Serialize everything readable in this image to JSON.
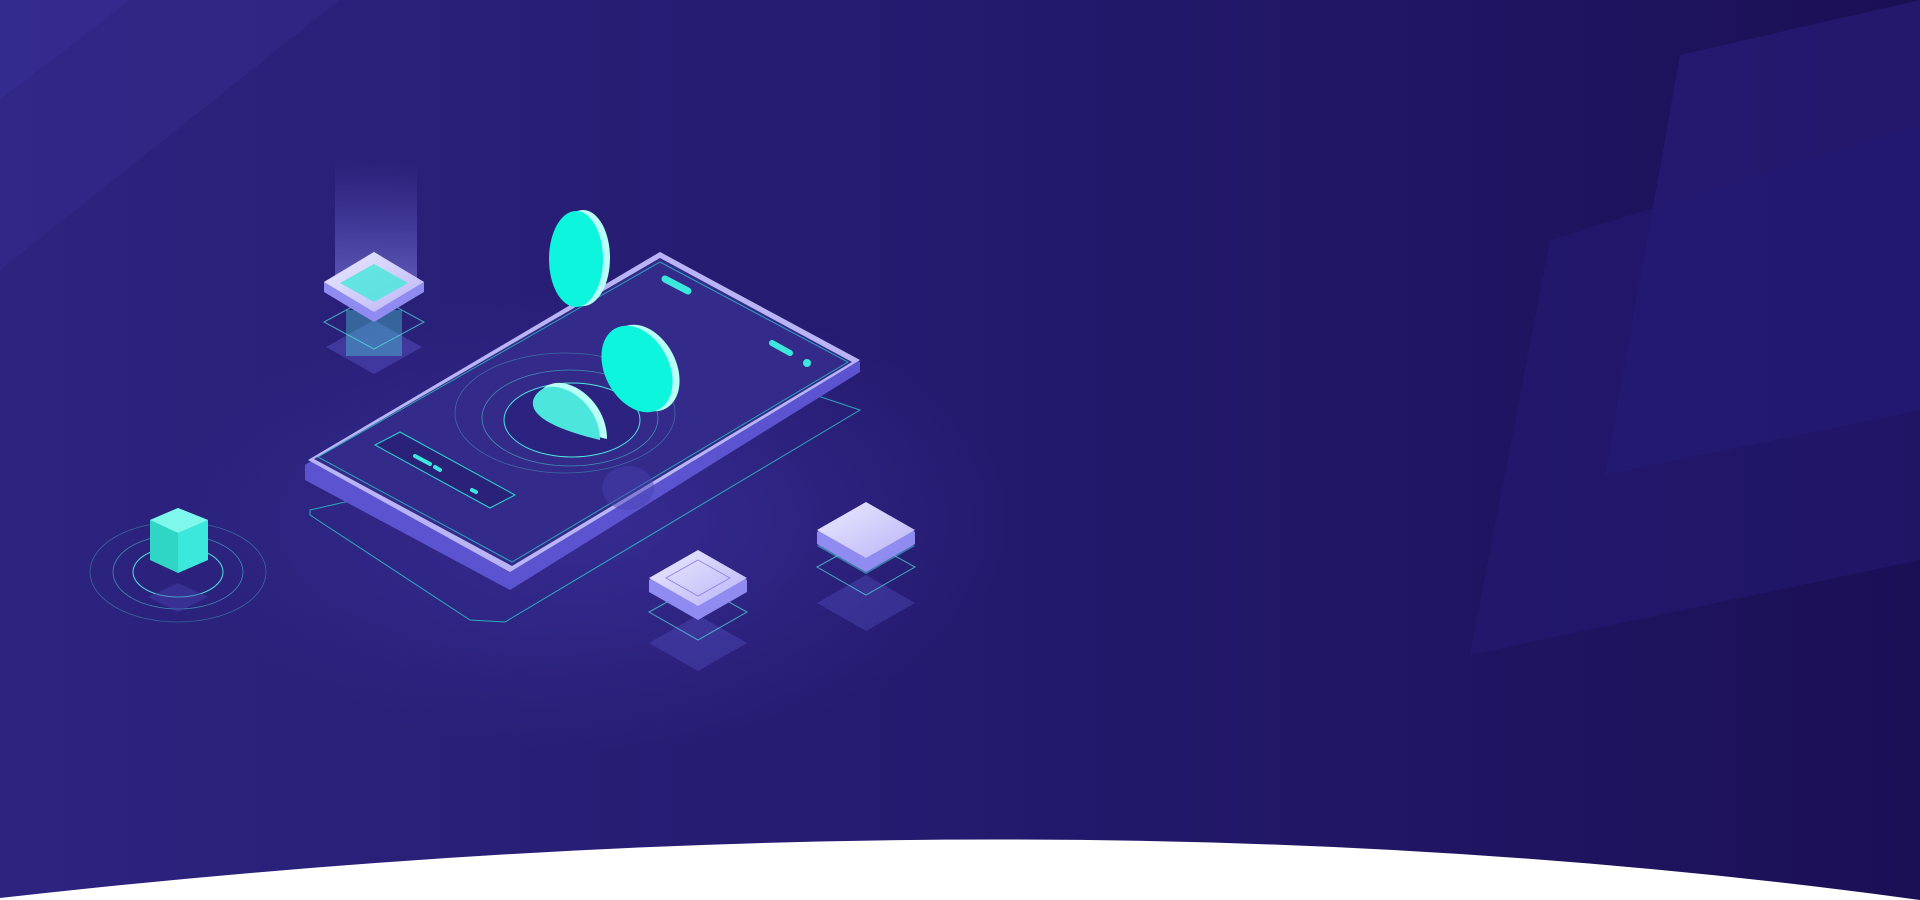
{
  "scene": {
    "description_free": true,
    "colors": {
      "background_left": "#2d2480",
      "background_right": "#1b1056",
      "accent_cyan": "#0ef5de",
      "cyan_soft": "#4de6dc",
      "phone_screen": "#332a8a",
      "phone_edge": "#7b73e8",
      "tile_light": "#d6d3fb",
      "curve_fill": "#ffffff"
    },
    "icons": [
      "phone-illustration-icon",
      "coin-icon",
      "cube-icon",
      "tile-icon"
    ]
  }
}
